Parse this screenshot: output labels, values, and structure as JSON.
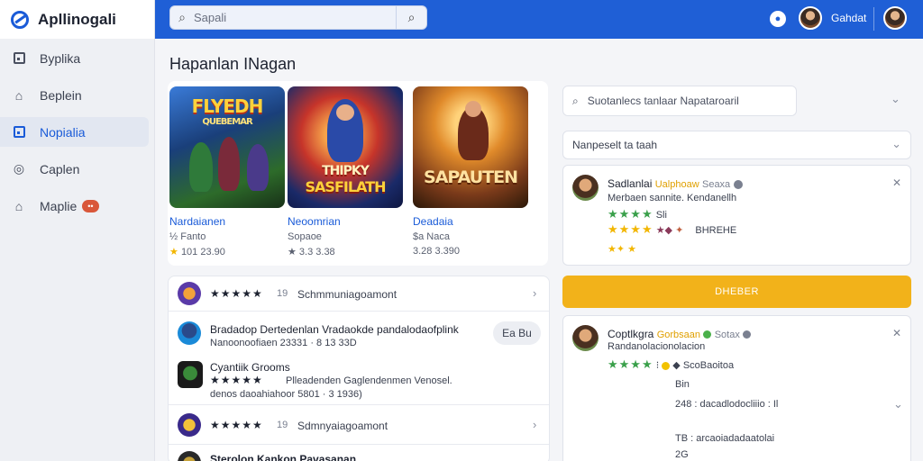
{
  "app": {
    "name": "Apllinogali"
  },
  "sidebar": {
    "items": [
      {
        "label": "Byplika",
        "icon": "square-icon",
        "active": false
      },
      {
        "label": "Beplein",
        "icon": "home-icon",
        "active": false
      },
      {
        "label": "Nopialia",
        "icon": "square-icon",
        "active": true
      },
      {
        "label": "Caplen",
        "icon": "compass-icon",
        "active": false
      },
      {
        "label": "Maplie",
        "icon": "house-icon",
        "active": false,
        "badge": "••"
      }
    ]
  },
  "topbar": {
    "search_placeholder": "Sapali",
    "user_name": "Gahdat",
    "colors": {
      "bar": "#1f5fd6"
    }
  },
  "page": {
    "title": "Hapanlan INagan"
  },
  "games": [
    {
      "art_title": "FLYEDH",
      "art_subtitle": "QUEBEMAR",
      "name": "Nardaianen",
      "sub": "½ Fanto",
      "meta": "101 23.90"
    },
    {
      "art_title": "THIPKY",
      "art_subtitle": "SASFILATH",
      "name": "Neoomrian",
      "sub": "Sopaoe",
      "meta": "★ 3.3 3.38"
    },
    {
      "art_title": "SAPAUTEN",
      "art_subtitle": "",
      "name": "Deadaia",
      "sub": "$a Naca",
      "meta": "3.28 3.390"
    }
  ],
  "list": {
    "rows": [
      {
        "stars": "★★★★★",
        "count": "19",
        "text": "Schmmuniagoamont"
      },
      {
        "title": "Bradadop Dertedenlan Vradaokde pandalodaofplink",
        "sub": "Nanoonoofiaen 23331 · 8 13 33D",
        "pill": "Ea Bu"
      },
      {
        "title": "Cyantiik Grooms",
        "stars": "★★★★★",
        "sub_right": "Plleadenden Gaglendenmen Venosel.",
        "sub": "denos daoahiahoor 5801 · 3 1936)"
      },
      {
        "stars": "★★★★★",
        "count": "19",
        "text": "Sdmnyaiagoamont"
      },
      {
        "title": "Sterolon Kankon Pavasanan"
      }
    ]
  },
  "right": {
    "search_placeholder": "Suotanlecs tanlaar Napataroaril",
    "select_value": "Nanpeselt ta taah",
    "reviews": [
      {
        "name": "Sadlanlai",
        "tag": "Ualphoaw",
        "extra": "Seaxa",
        "line1": "Merbaen sannite. Kendanellh",
        "rating_stars": "★★★★",
        "rating_text": "Sli",
        "line3": "BHREHE"
      },
      {
        "name": "Coptlkgra",
        "tag": "Gorbsaan",
        "extra": "Sotax",
        "line1": "Randanolacionolacion",
        "rating_text": "ScoBaoitoa",
        "line3": "Bin",
        "line4": "248 : dacadlodocliiio : Il",
        "line5": "TB : arcaoiadadaatolai",
        "line6": "2G"
      }
    ],
    "cta_label": "DHEBER"
  }
}
